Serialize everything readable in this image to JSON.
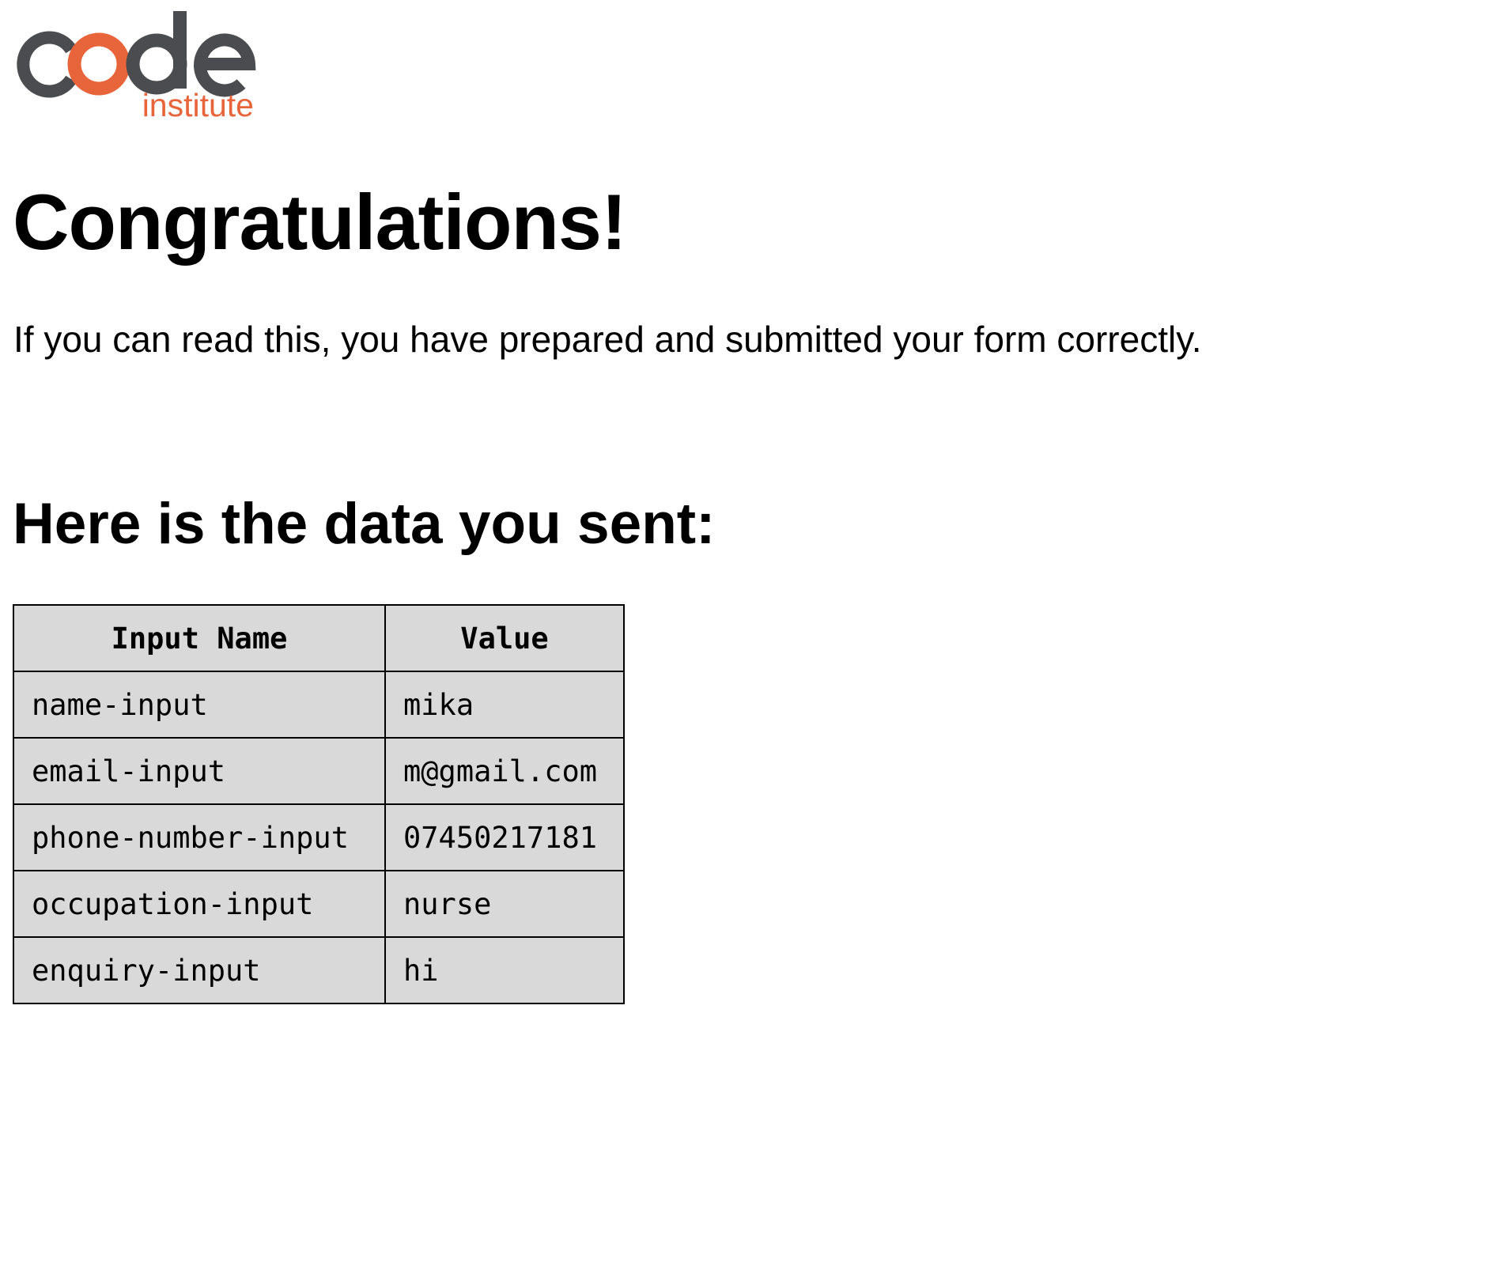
{
  "logo": {
    "main_text": "code",
    "sub_text": "institute",
    "colors": {
      "dark": "#4a4c50",
      "accent": "#e8643a"
    }
  },
  "page": {
    "title": "Congratulations!",
    "intro": "If you can read this, you have prepared and submitted your form correctly.",
    "subheading": "Here is the data you sent:"
  },
  "table": {
    "headers": [
      "Input Name",
      "Value"
    ],
    "rows": [
      [
        "name-input",
        "mika"
      ],
      [
        "email-input",
        "m@gmail.com"
      ],
      [
        "phone-number-input",
        "07450217181"
      ],
      [
        "occupation-input",
        "nurse"
      ],
      [
        "enquiry-input",
        "hi"
      ]
    ],
    "colors": {
      "background": "#d9d9d9",
      "border": "#000000"
    }
  }
}
